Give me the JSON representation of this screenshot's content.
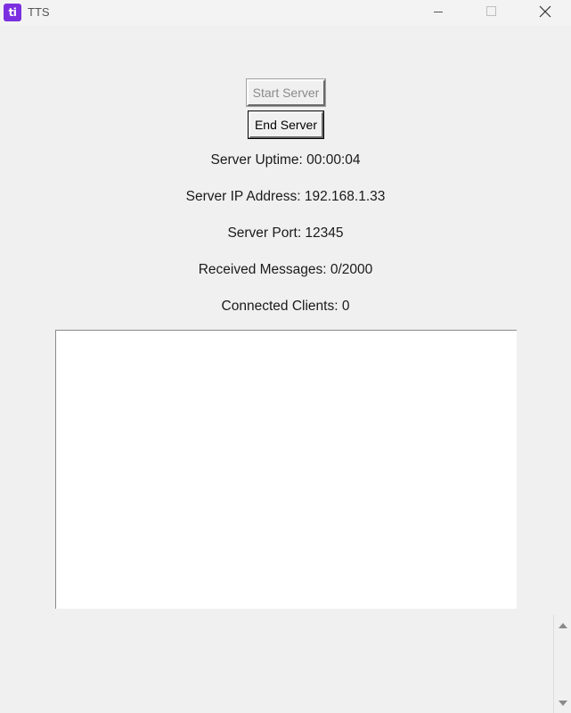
{
  "window": {
    "title": "TTS",
    "icon_text": "ti",
    "icon_color": "#7b2fe0"
  },
  "controls": {
    "start_label": "Start Server",
    "end_label": "End Server"
  },
  "info": {
    "uptime": "Server Uptime: 00:00:04",
    "ip": "Server IP Address: 192.168.1.33",
    "port": "Server Port: 12345",
    "received": "Received Messages: 0/2000",
    "clients": "Connected Clients: 0"
  },
  "log": {
    "content": ""
  },
  "icons": {
    "minimize": "minimize-icon",
    "maximize": "maximize-icon",
    "close": "close-icon",
    "scroll_up": "scroll-up-arrow-icon",
    "scroll_down": "scroll-down-arrow-icon"
  }
}
